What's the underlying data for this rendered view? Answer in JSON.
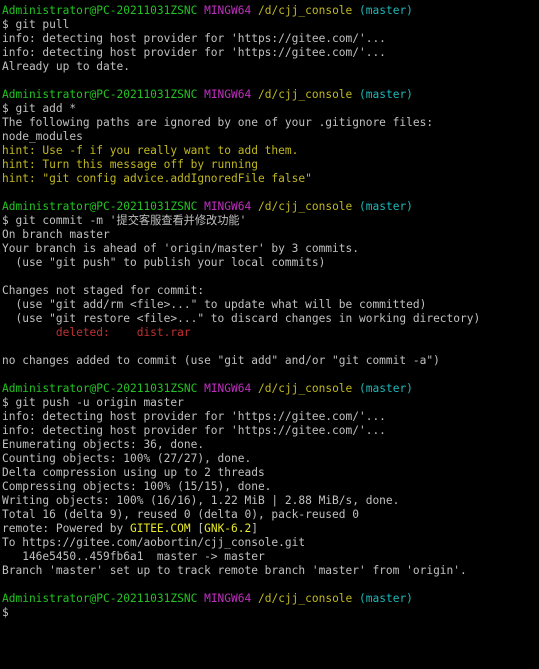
{
  "colors": {
    "background": "#000000",
    "default_text": "#c0c0c0",
    "prompt_user": "#22c322",
    "prompt_system": "#c030c0",
    "prompt_path": "#c0b820",
    "prompt_branch": "#1fb7b7",
    "hint": "#c0b820",
    "deleted": "#c03030",
    "highlight": "#e8e82a"
  },
  "prompt": {
    "user_host": "Administrator@PC-20211031ZSNC",
    "system": "MINGW64",
    "path": "/d/cjj_console",
    "branch": "(master)"
  },
  "lines": [
    {
      "segs": [
        {
          "t": "Administrator@PC-20211031ZSNC",
          "c": "green"
        },
        {
          "t": " ",
          "c": "white"
        },
        {
          "t": "MINGW64",
          "c": "magenta"
        },
        {
          "t": " ",
          "c": "white"
        },
        {
          "t": "/d/cjj_console",
          "c": "yellow"
        },
        {
          "t": " ",
          "c": "white"
        },
        {
          "t": "(master)",
          "c": "cyan"
        }
      ]
    },
    {
      "segs": [
        {
          "t": "$ git pull",
          "c": "white"
        }
      ]
    },
    {
      "segs": [
        {
          "t": "info: detecting host provider for 'https://gitee.com/'...",
          "c": "white"
        }
      ]
    },
    {
      "segs": [
        {
          "t": "info: detecting host provider for 'https://gitee.com/'...",
          "c": "white"
        }
      ]
    },
    {
      "segs": [
        {
          "t": "Already up to date.",
          "c": "white"
        }
      ]
    },
    {
      "segs": []
    },
    {
      "segs": [
        {
          "t": "Administrator@PC-20211031ZSNC",
          "c": "green"
        },
        {
          "t": " ",
          "c": "white"
        },
        {
          "t": "MINGW64",
          "c": "magenta"
        },
        {
          "t": " ",
          "c": "white"
        },
        {
          "t": "/d/cjj_console",
          "c": "yellow"
        },
        {
          "t": " ",
          "c": "white"
        },
        {
          "t": "(master)",
          "c": "cyan"
        }
      ]
    },
    {
      "segs": [
        {
          "t": "$ git add *",
          "c": "white"
        }
      ]
    },
    {
      "segs": [
        {
          "t": "The following paths are ignored by one of your .gitignore files:",
          "c": "white"
        }
      ]
    },
    {
      "segs": [
        {
          "t": "node_modules",
          "c": "white"
        }
      ]
    },
    {
      "segs": [
        {
          "t": "hint: Use -f if you really want to add them.",
          "c": "yellow"
        }
      ]
    },
    {
      "segs": [
        {
          "t": "hint: Turn this message off by running",
          "c": "yellow"
        }
      ]
    },
    {
      "segs": [
        {
          "t": "hint: \"git config advice.addIgnoredFile false\"",
          "c": "yellow"
        }
      ]
    },
    {
      "segs": []
    },
    {
      "segs": [
        {
          "t": "Administrator@PC-20211031ZSNC",
          "c": "green"
        },
        {
          "t": " ",
          "c": "white"
        },
        {
          "t": "MINGW64",
          "c": "magenta"
        },
        {
          "t": " ",
          "c": "white"
        },
        {
          "t": "/d/cjj_console",
          "c": "yellow"
        },
        {
          "t": " ",
          "c": "white"
        },
        {
          "t": "(master)",
          "c": "cyan"
        }
      ]
    },
    {
      "segs": [
        {
          "t": "$ git commit -m '提交客服查看并修改功能'",
          "c": "white"
        }
      ]
    },
    {
      "segs": [
        {
          "t": "On branch master",
          "c": "white"
        }
      ]
    },
    {
      "segs": [
        {
          "t": "Your branch is ahead of 'origin/master' by 3 commits.",
          "c": "white"
        }
      ]
    },
    {
      "segs": [
        {
          "t": "  (use \"git push\" to publish your local commits)",
          "c": "white"
        }
      ]
    },
    {
      "segs": []
    },
    {
      "segs": [
        {
          "t": "Changes not staged for commit:",
          "c": "white"
        }
      ]
    },
    {
      "segs": [
        {
          "t": "  (use \"git add/rm <file>...\" to update what will be committed)",
          "c": "white"
        }
      ]
    },
    {
      "segs": [
        {
          "t": "  (use \"git restore <file>...\" to discard changes in working directory)",
          "c": "white"
        }
      ]
    },
    {
      "segs": [
        {
          "t": "        deleted:    dist.rar",
          "c": "red"
        }
      ]
    },
    {
      "segs": []
    },
    {
      "segs": [
        {
          "t": "no changes added to commit (use \"git add\" and/or \"git commit -a\")",
          "c": "white"
        }
      ]
    },
    {
      "segs": []
    },
    {
      "segs": [
        {
          "t": "Administrator@PC-20211031ZSNC",
          "c": "green"
        },
        {
          "t": " ",
          "c": "white"
        },
        {
          "t": "MINGW64",
          "c": "magenta"
        },
        {
          "t": " ",
          "c": "white"
        },
        {
          "t": "/d/cjj_console",
          "c": "yellow"
        },
        {
          "t": " ",
          "c": "white"
        },
        {
          "t": "(master)",
          "c": "cyan"
        }
      ]
    },
    {
      "segs": [
        {
          "t": "$ git push -u origin master",
          "c": "white"
        }
      ]
    },
    {
      "segs": [
        {
          "t": "info: detecting host provider for 'https://gitee.com/'...",
          "c": "white"
        }
      ]
    },
    {
      "segs": [
        {
          "t": "info: detecting host provider for 'https://gitee.com/'...",
          "c": "white"
        }
      ]
    },
    {
      "segs": [
        {
          "t": "Enumerating objects: 36, done.",
          "c": "white"
        }
      ]
    },
    {
      "segs": [
        {
          "t": "Counting objects: 100% (27/27), done.",
          "c": "white"
        }
      ]
    },
    {
      "segs": [
        {
          "t": "Delta compression using up to 2 threads",
          "c": "white"
        }
      ]
    },
    {
      "segs": [
        {
          "t": "Compressing objects: 100% (15/15), done.",
          "c": "white"
        }
      ]
    },
    {
      "segs": [
        {
          "t": "Writing objects: 100% (16/16), 1.22 MiB | 2.88 MiB/s, done.",
          "c": "white"
        }
      ]
    },
    {
      "segs": [
        {
          "t": "Total 16 (delta 9), reused 0 (delta 0), pack-reused 0",
          "c": "white"
        }
      ]
    },
    {
      "segs": [
        {
          "t": "remote: Powered by ",
          "c": "white"
        },
        {
          "t": "GITEE.COM",
          "c": "bright-yellow"
        },
        {
          "t": " [",
          "c": "white"
        },
        {
          "t": "GNK-6.2",
          "c": "bright-yellow"
        },
        {
          "t": "]",
          "c": "white"
        }
      ]
    },
    {
      "segs": [
        {
          "t": "To https://gitee.com/aobortin/cjj_console.git",
          "c": "white"
        }
      ]
    },
    {
      "segs": [
        {
          "t": "   146e5450..459fb6a1  master -> master",
          "c": "white"
        }
      ]
    },
    {
      "segs": [
        {
          "t": "Branch 'master' set up to track remote branch 'master' from 'origin'.",
          "c": "white"
        }
      ]
    },
    {
      "segs": []
    },
    {
      "segs": [
        {
          "t": "Administrator@PC-20211031ZSNC",
          "c": "green"
        },
        {
          "t": " ",
          "c": "white"
        },
        {
          "t": "MINGW64",
          "c": "magenta"
        },
        {
          "t": " ",
          "c": "white"
        },
        {
          "t": "/d/cjj_console",
          "c": "yellow"
        },
        {
          "t": " ",
          "c": "white"
        },
        {
          "t": "(master)",
          "c": "cyan"
        }
      ]
    },
    {
      "segs": [
        {
          "t": "$ ",
          "c": "white"
        }
      ]
    }
  ]
}
